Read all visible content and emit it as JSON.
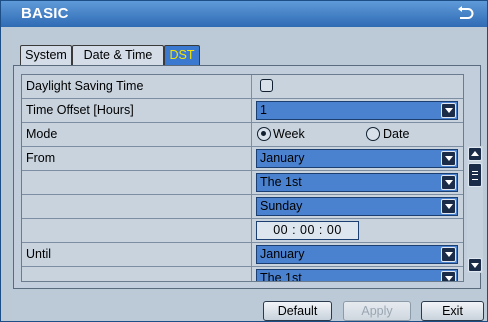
{
  "window": {
    "title": "BASIC",
    "back_icon": "return-arrow-icon"
  },
  "tabs": [
    {
      "label": "System",
      "active": false
    },
    {
      "label": "Date & Time",
      "active": false
    },
    {
      "label": "DST",
      "active": true
    }
  ],
  "rows": {
    "dst": {
      "label": "Daylight Saving Time",
      "checked": false
    },
    "offset": {
      "label": "Time Offset [Hours]",
      "value": "1"
    },
    "mode": {
      "label": "Mode",
      "options": [
        "Week",
        "Date"
      ],
      "selected": "Week"
    },
    "from": {
      "label": "From",
      "month": "January",
      "week": "The 1st",
      "day": "Sunday",
      "time": "00 : 00 : 00"
    },
    "until": {
      "label": "Until",
      "month": "January",
      "week": "The 1st"
    }
  },
  "buttons": {
    "default": "Default",
    "apply": "Apply",
    "exit": "Exit"
  },
  "colors": {
    "title_bar": "#2f6bb4",
    "active_tab": "#3b79d0",
    "active_tab_text": "#f5e400",
    "dropdown": "#4a82d0"
  }
}
